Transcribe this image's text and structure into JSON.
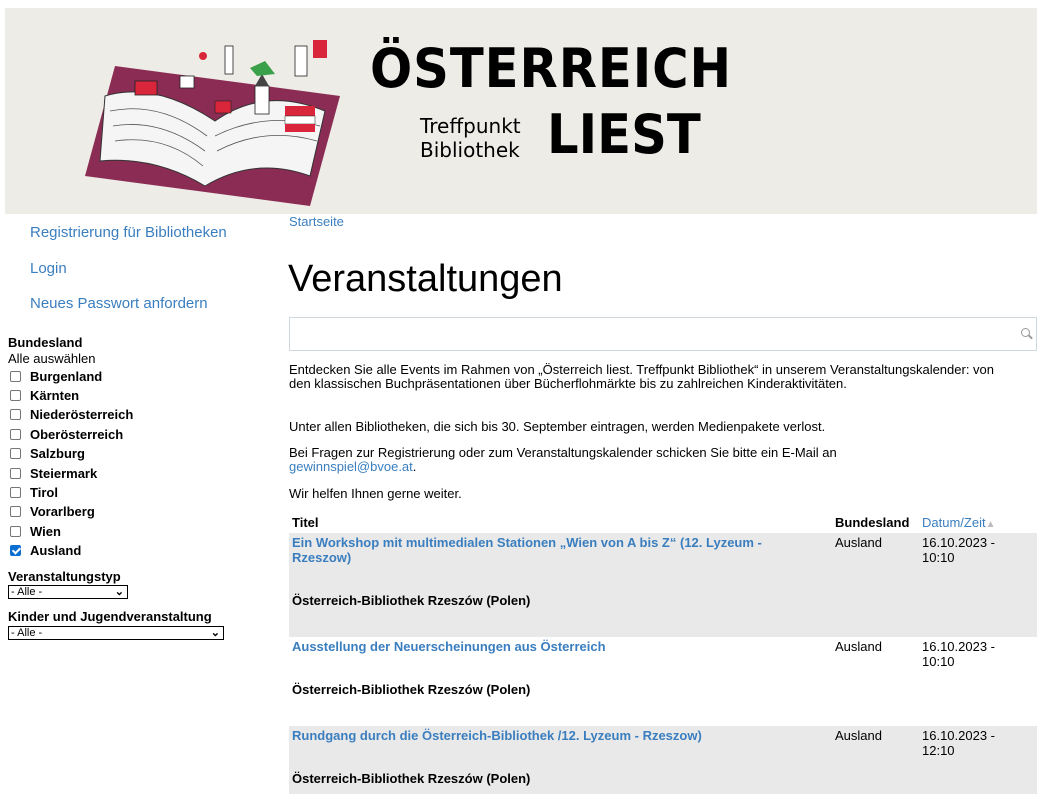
{
  "brand": {
    "title": "ÖSTERREICH",
    "sub_line1": "Treffpunkt",
    "sub_line2": "Bibliothek",
    "liest": "LIEST"
  },
  "sidebar": {
    "links": [
      "Registrierung für Bibliotheken",
      "Login",
      "Neues Passwort anfordern"
    ],
    "bundesland_label": "Bundesland",
    "select_all": "Alle auswählen",
    "states": [
      {
        "label": "Burgenland",
        "checked": false
      },
      {
        "label": "Kärnten",
        "checked": false
      },
      {
        "label": "Niederösterreich",
        "checked": false
      },
      {
        "label": "Oberösterreich",
        "checked": false
      },
      {
        "label": "Salzburg",
        "checked": false
      },
      {
        "label": "Steiermark",
        "checked": false
      },
      {
        "label": "Tirol",
        "checked": false
      },
      {
        "label": "Vorarlberg",
        "checked": false
      },
      {
        "label": "Wien",
        "checked": false
      },
      {
        "label": "Ausland",
        "checked": true
      }
    ],
    "type_label": "Veranstaltungstyp",
    "type_value": "- Alle -",
    "kids_label": "Kinder und Jugendveranstaltung",
    "kids_value": "- Alle -"
  },
  "main": {
    "breadcrumb": "Startseite",
    "title": "Veranstaltungen",
    "search_placeholder": "",
    "intro": "Entdecken Sie alle Events im Rahmen von „Österreich liest. Treffpunkt Bibliothek“ in unserem Veranstaltungskalender: von den klassischen Buchpräsentationen über Bücherflohmärkte bis zu zahlreichen Kinderaktivitäten.",
    "raffle": "Unter allen Bibliotheken, die sich bis 30. September eintragen, werden Medienpakete verlost.",
    "contact_prefix": "Bei Fragen zur Registrierung oder zum Veranstaltungskalender schicken Sie bitte ein E-Mail an",
    "contact_email": "gewinnspiel@bvoe.at",
    "contact_suffix": ".",
    "help": "Wir helfen Ihnen gerne weiter."
  },
  "table": {
    "col_title": "Titel",
    "col_state": "Bundesland",
    "col_date": "Datum/Zeit",
    "sort_icon": "sort-asc-icon",
    "rows": [
      {
        "title": "Ein Workshop mit multimedialen Stationen „Wien von A bis Z“ (12. Lyzeum - Rzeszow)",
        "place": "Österreich-Bibliothek Rzeszów (Polen)",
        "state": "Ausland",
        "date": "16.10.2023 - 10:10",
        "shaded": true
      },
      {
        "title": "Ausstellung der Neuerscheinungen aus Österreich",
        "place": "Österreich-Bibliothek Rzeszów (Polen)",
        "state": "Ausland",
        "date": "16.10.2023 - 10:10",
        "shaded": false
      },
      {
        "title": "Rundgang durch die Österreich-Bibliothek /12. Lyzeum - Rzeszow)",
        "place": "Österreich-Bibliothek Rzeszów (Polen)",
        "state": "Ausland",
        "date": "16.10.2023 - 12:10",
        "shaded": true
      }
    ]
  },
  "colors": {
    "link": "#3a7ebf",
    "header_bg": "#eeece6",
    "row_shade": "#e9e9e9",
    "book_cover": "#8b2c55",
    "flag_red": "#d9263a"
  }
}
